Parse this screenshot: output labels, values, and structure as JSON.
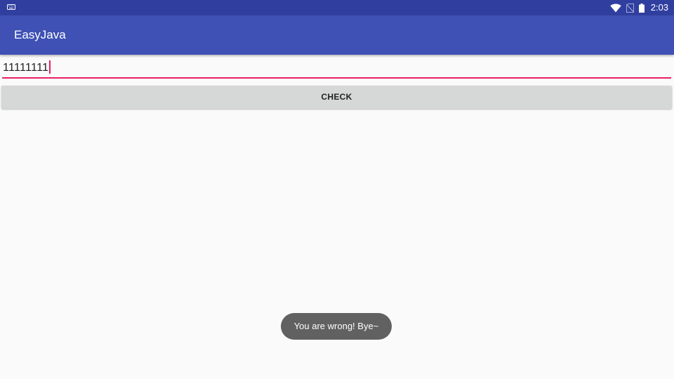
{
  "status_bar": {
    "time": "2:03",
    "icons": [
      "keyboard-icon",
      "wifi-icon",
      "no-sim-icon",
      "battery-icon"
    ]
  },
  "app_bar": {
    "title": "EasyJava"
  },
  "input": {
    "value": "11111111"
  },
  "check_button": {
    "label": "CHECK"
  },
  "toast": {
    "message": "You are wrong! Bye~"
  },
  "colors": {
    "status_bar": "#303f9f",
    "app_bar": "#3f51b5",
    "accent": "#e91e63",
    "background": "#fafafa",
    "button": "#d6d7d7",
    "toast": "#616161"
  }
}
